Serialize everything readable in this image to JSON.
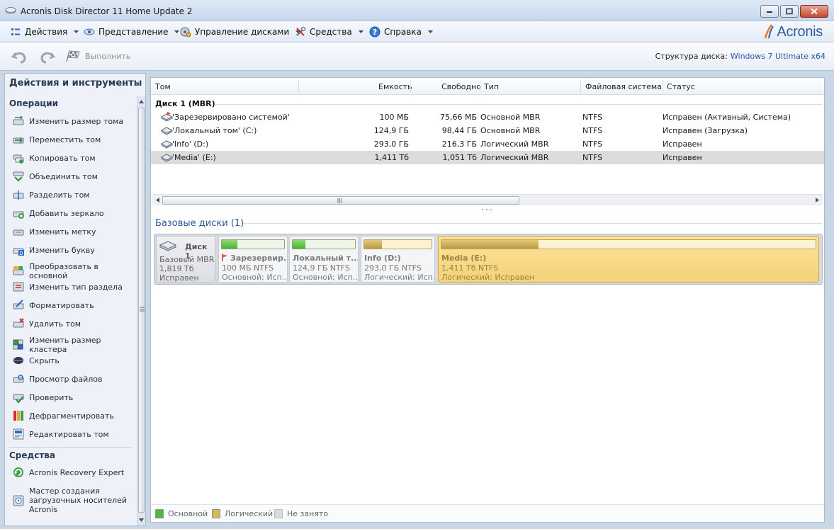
{
  "window": {
    "title": "Acronis Disk Director 11 Home Update 2"
  },
  "menu": {
    "items": [
      {
        "label": "Действия",
        "icon": "actions-icon"
      },
      {
        "label": "Представление",
        "icon": "eye-icon"
      },
      {
        "label": "Управление дисками",
        "icon": "disk-management-icon"
      },
      {
        "label": "Средства",
        "icon": "tools-icon"
      },
      {
        "label": "Справка",
        "icon": "help-icon"
      }
    ],
    "logo_text": "Acronis"
  },
  "toolbar": {
    "run_label": "Выполнить",
    "disk_structure_label": "Структура диска:",
    "disk_structure_value": "Windows 7 Ultimate x64"
  },
  "left_panel": {
    "title": "Действия и инструменты",
    "collapse_glyph": "«",
    "operations_title": "Операции",
    "operations": [
      {
        "label": "Изменить размер тома",
        "icon": "resize-volume-icon"
      },
      {
        "label": "Переместить том",
        "icon": "move-volume-icon"
      },
      {
        "label": "Копировать том",
        "icon": "copy-volume-icon"
      },
      {
        "label": "Объединить том",
        "icon": "merge-volume-icon"
      },
      {
        "label": "Разделить том",
        "icon": "split-volume-icon"
      },
      {
        "label": "Добавить зеркало",
        "icon": "add-mirror-icon"
      },
      {
        "label": "Изменить метку",
        "icon": "change-label-icon"
      },
      {
        "label": "Изменить букву",
        "icon": "change-letter-icon"
      },
      {
        "label": "Преобразовать в основной",
        "icon": "convert-primary-icon"
      },
      {
        "label": "Изменить тип раздела",
        "icon": "change-partition-type-icon"
      },
      {
        "label": "Форматировать",
        "icon": "format-icon"
      },
      {
        "label": "Удалить том",
        "icon": "delete-volume-icon"
      },
      {
        "label": "Изменить размер кластера",
        "icon": "cluster-size-icon"
      },
      {
        "label": "Скрыть",
        "icon": "hide-icon"
      },
      {
        "label": "Просмотр файлов",
        "icon": "browse-files-icon"
      },
      {
        "label": "Проверить",
        "icon": "check-icon"
      },
      {
        "label": "Дефрагментировать",
        "icon": "defragment-icon"
      },
      {
        "label": "Редактировать том",
        "icon": "edit-volume-icon"
      }
    ],
    "tools_title": "Средства",
    "tools": [
      {
        "label": "Acronis Recovery Expert",
        "icon": "recovery-expert-icon"
      },
      {
        "label": "Мастер создания загрузочных носителей Acronis",
        "icon": "bootable-media-icon"
      }
    ]
  },
  "table": {
    "columns": [
      "Том",
      "Емкость",
      "Свободно",
      "Тип",
      "Файловая система",
      "Статус"
    ],
    "group_label": "Диск 1 (MBR)",
    "rows": [
      {
        "name": "'Зарезервировано системой'",
        "capacity": "100 МБ",
        "free": "75,66 МБ",
        "type": "Основной MBR",
        "fs": "NTFS",
        "status": "Исправен (Активный, Система)"
      },
      {
        "name": "'Локальный том' (C:)",
        "capacity": "124,9 ГБ",
        "free": "98,44 ГБ",
        "type": "Основной MBR",
        "fs": "NTFS",
        "status": "Исправен (Загрузка)"
      },
      {
        "name": "'Info' (D:)",
        "capacity": "293,0 ГБ",
        "free": "216,3 ГБ",
        "type": "Логический MBR",
        "fs": "NTFS",
        "status": "Исправен"
      },
      {
        "name": "'Media' (E:)",
        "capacity": "1,411 Тб",
        "free": "1,051 Тб",
        "type": "Логический MBR",
        "fs": "NTFS",
        "status": "Исправен"
      }
    ],
    "selected_row": 3
  },
  "basic_disks": {
    "title": "Базовые диски (1)",
    "disk": {
      "name": "Диск 1",
      "type": "Базовый MBR",
      "size": "1,819 Тб",
      "status": "Исправен"
    },
    "partitions": [
      {
        "name": "Зарезервир...",
        "size_fs": "100 МБ NTFS",
        "info": "Основной; Исп...",
        "kind": "primary",
        "used_fraction": 0.25
      },
      {
        "name": "Локальный т...",
        "size_fs": "124,9 ГБ NTFS",
        "info": "Основной; Исп...",
        "kind": "primary",
        "used_fraction": 0.21
      },
      {
        "name": "Info (D:)",
        "size_fs": "293,0 ГБ NTFS",
        "info": "Логический; Исп...",
        "kind": "logical",
        "used_fraction": 0.26
      },
      {
        "name": "Media (E:)",
        "size_fs": "1,411 Тб NTFS",
        "info": "Логический; Исправен",
        "kind": "logical",
        "used_fraction": 0.26
      }
    ]
  },
  "legend": {
    "items": [
      {
        "label": "Основной",
        "color": "#52b83b"
      },
      {
        "label": "Логический",
        "color": "#d9b85c"
      },
      {
        "label": "Не занято",
        "color": "#d9dbe0"
      }
    ]
  },
  "colors": {
    "accent": "#2c56a6",
    "selected_partition": "#f5d27a",
    "selected_row": "#dcdcdc"
  }
}
